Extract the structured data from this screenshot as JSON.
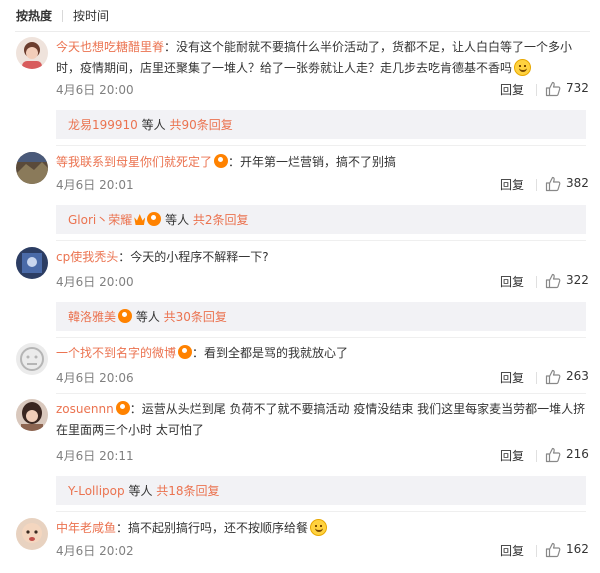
{
  "sort_tabs": {
    "hot": "按热度",
    "time": "按时间"
  },
  "comments": [
    {
      "user": "今天也想吃糖醋里脊",
      "text": "：没有这个能耐就不要搞什么半价活动了，货都不足，让人白白等了一个多小时，疫情期间，店里还聚集了一堆人？给了一张劵就让人走？走几步去吃肯德基不香吗",
      "time": "4月6日 20:00",
      "reply": "回复",
      "likes": "732",
      "sub_user": "龙易199910",
      "sub_mid": " 等人 ",
      "sub_count": "共90条回复",
      "avatar_color": "#c89a8a"
    },
    {
      "user": "等我联系到母星你们就死定了",
      "text": "：开年第一烂营销，搞不了别搞",
      "time": "4月6日 20:01",
      "reply": "回复",
      "likes": "382",
      "sub_user": "Glori丶荣耀",
      "sub_mid": " 等人 ",
      "sub_count": "共2条回复",
      "avatar_color": "#6c5a3e"
    },
    {
      "user": "cp使我秃头",
      "text": "：今天的小程序不解释一下?",
      "time": "4月6日 20:00",
      "reply": "回复",
      "likes": "322",
      "sub_user": "韓洛雅美",
      "sub_mid": " 等人 ",
      "sub_count": "共30条回复",
      "avatar_color": "#3e5f9a"
    },
    {
      "user": "一个找不到名字的微博",
      "text": "：看到全都是骂的我就放心了",
      "time": "4月6日 20:06",
      "reply": "回复",
      "likes": "263",
      "avatar_color": "#d8d8d8"
    },
    {
      "user": "zosuennn",
      "text": "：运营从头烂到尾 负荷不了就不要搞活动 疫情没结束 我们这里每家麦当劳都一堆人挤在里面两三个小时 太可怕了",
      "time": "4月6日 20:11",
      "reply": "回复",
      "likes": "216",
      "sub_user": "Y-Lollipop",
      "sub_mid": " 等人 ",
      "sub_count": "共18条回复",
      "avatar_color": "#7a5a4a"
    },
    {
      "user": "中年老咸鱼",
      "text": "：搞不起别搞行吗，还不按顺序给餐",
      "time": "4月6日 20:02",
      "reply": "回复",
      "likes": "162",
      "avatar_color": "#c9a88c"
    }
  ]
}
